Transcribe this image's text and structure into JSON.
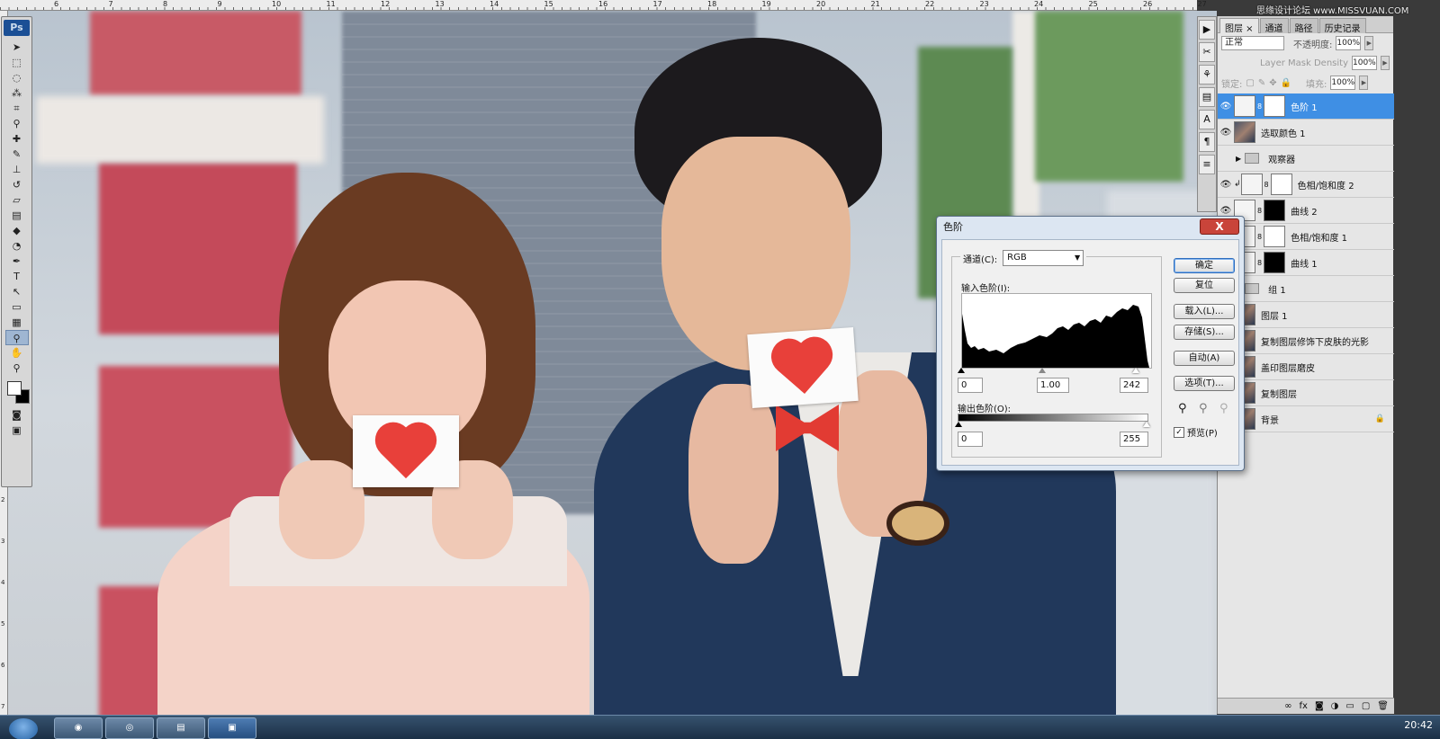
{
  "app": {
    "logo": "Ps"
  },
  "watermark": "思缘设计论坛 www.MISSVUAN.COM",
  "ruler": {
    "top_labels": [
      "6",
      "7",
      "8",
      "9",
      "10",
      "11",
      "12",
      "13",
      "14",
      "15",
      "16",
      "17",
      "18",
      "19",
      "20",
      "21",
      "22",
      "23",
      "24",
      "25",
      "26",
      "27"
    ],
    "left_labels": [
      "2",
      "3",
      "4",
      "5",
      "6",
      "7"
    ]
  },
  "tools": [
    {
      "name": "move-tool-icon",
      "glyph": "➤"
    },
    {
      "name": "marquee-tool-icon",
      "glyph": "⬚"
    },
    {
      "name": "lasso-tool-icon",
      "glyph": "◌"
    },
    {
      "name": "magic-wand-tool-icon",
      "glyph": "⁂"
    },
    {
      "name": "crop-tool-icon",
      "glyph": "⌗"
    },
    {
      "name": "eyedropper-tool-icon",
      "glyph": "⚲"
    },
    {
      "name": "healing-brush-tool-icon",
      "glyph": "✚"
    },
    {
      "name": "brush-tool-icon",
      "glyph": "✎"
    },
    {
      "name": "clone-stamp-tool-icon",
      "glyph": "⊥"
    },
    {
      "name": "history-brush-tool-icon",
      "glyph": "↺"
    },
    {
      "name": "eraser-tool-icon",
      "glyph": "▱"
    },
    {
      "name": "gradient-tool-icon",
      "glyph": "▤"
    },
    {
      "name": "blur-tool-icon",
      "glyph": "◆"
    },
    {
      "name": "dodge-tool-icon",
      "glyph": "◔"
    },
    {
      "name": "pen-tool-icon",
      "glyph": "✒"
    },
    {
      "name": "type-tool-icon",
      "glyph": "T"
    },
    {
      "name": "path-selection-tool-icon",
      "glyph": "↖"
    },
    {
      "name": "shape-tool-icon",
      "glyph": "▭"
    },
    {
      "name": "notes-tool-icon",
      "glyph": "▦"
    },
    {
      "name": "eyedropper-active-tool-icon",
      "glyph": "⚲",
      "active": true
    },
    {
      "name": "hand-tool-icon",
      "glyph": "✋"
    },
    {
      "name": "zoom-tool-icon",
      "glyph": "⚲"
    }
  ],
  "tools_bottom": [
    {
      "name": "quick-mask-icon",
      "glyph": "◙"
    },
    {
      "name": "screen-mode-icon",
      "glyph": "▣"
    }
  ],
  "dock": [
    {
      "name": "play-icon",
      "glyph": "▶"
    },
    {
      "name": "tools-icon",
      "glyph": "✂"
    },
    {
      "name": "clone-source-icon",
      "glyph": "⚘"
    },
    {
      "name": "history-icon",
      "glyph": "▤"
    },
    {
      "name": "character-icon",
      "glyph": "A"
    },
    {
      "name": "paragraph-icon",
      "glyph": "¶"
    },
    {
      "name": "layer-comps-icon",
      "glyph": "≡"
    }
  ],
  "layers_panel": {
    "tabs": [
      "图层",
      "通道",
      "路径",
      "历史记录"
    ],
    "blend_mode": "正常",
    "opacity_label": "不透明度:",
    "opacity_value": "100%",
    "mask_density_label": "Layer Mask Density",
    "mask_density_value": "100%",
    "lock_label": "锁定:",
    "fill_label": "填充:",
    "fill_value": "100%",
    "layers": [
      {
        "name": "色阶 1",
        "eye": true,
        "thumb": "adj",
        "mask": "mask-w",
        "selected": true
      },
      {
        "name": "选取颜色 1",
        "eye": true,
        "thumb": "photo",
        "mask": ""
      },
      {
        "name": "观察器",
        "eye": false,
        "group": true
      },
      {
        "name": "色相/饱和度 2",
        "eye": true,
        "thumb": "adj",
        "mask": "mask-w",
        "clip": true
      },
      {
        "name": "曲线 2",
        "eye": true,
        "thumb": "adj",
        "mask": "mask-b"
      },
      {
        "name": "色相/饱和度 1",
        "eye": true,
        "thumb": "adj",
        "mask": "mask-w"
      },
      {
        "name": "曲线 1",
        "eye": true,
        "thumb": "adj",
        "mask": "mask-b"
      },
      {
        "name": "组 1",
        "eye": true,
        "group": true
      },
      {
        "name": "图层 1",
        "eye": true,
        "thumb": "photo",
        "mask": ""
      },
      {
        "name": "复制图层修饰下皮肤的光影",
        "eye": true,
        "thumb": "photo",
        "mask": ""
      },
      {
        "name": "盖印图层磨皮",
        "eye": true,
        "thumb": "photo",
        "mask": ""
      },
      {
        "name": "复制图层",
        "eye": true,
        "thumb": "photo",
        "mask": ""
      },
      {
        "name": "背景",
        "eye": true,
        "thumb": "photo",
        "mask": "",
        "locked": true
      }
    ],
    "footer_icons": [
      "∞",
      "fx",
      "◙",
      "◑",
      "▭",
      "▢",
      "🗑"
    ]
  },
  "levels_dialog": {
    "title": "色阶",
    "close": "X",
    "channel_label": "通道(C):",
    "channel_value": "RGB",
    "input_label": "输入色阶(I):",
    "input_black": "0",
    "input_gamma": "1.00",
    "input_white": "242",
    "output_label": "输出色阶(O):",
    "output_black": "0",
    "output_white": "255",
    "buttons": [
      "确定",
      "复位",
      "载入(L)...",
      "存储(S)...",
      "自动(A)",
      "选项(T)..."
    ],
    "preview_label": "预览(P)",
    "preview_checked": "✓"
  },
  "taskbar": {
    "clock": "20:42"
  }
}
